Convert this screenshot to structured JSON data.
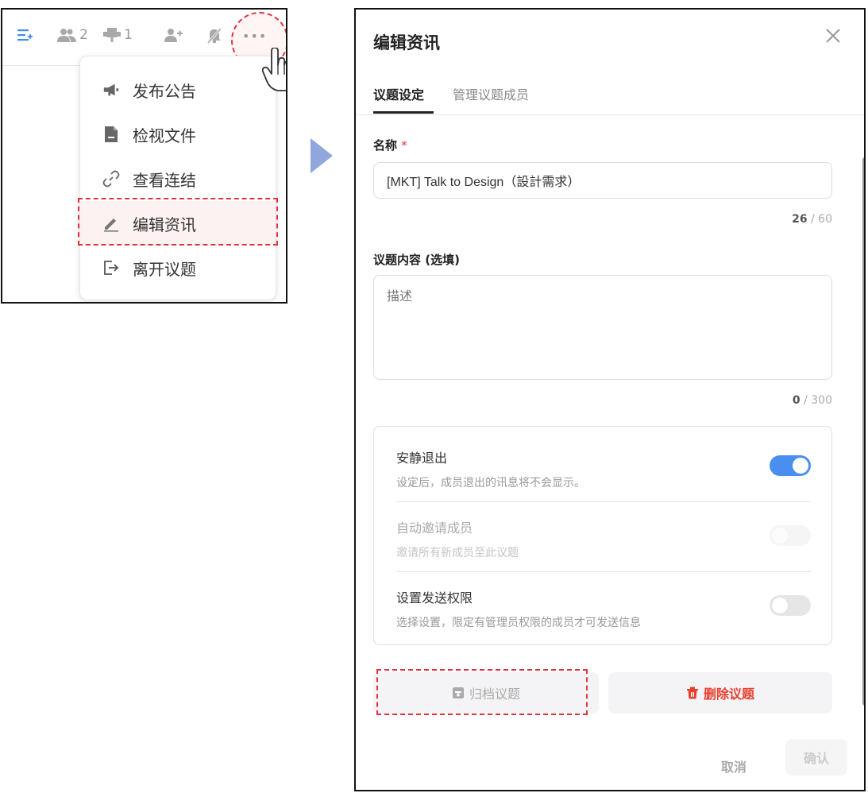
{
  "topbar": {
    "members_count": "2",
    "pin_count": "1",
    "more_label": "•••"
  },
  "menu": {
    "items": [
      {
        "label": "发布公告",
        "icon": "megaphone-icon"
      },
      {
        "label": "检视文件",
        "icon": "file-icon"
      },
      {
        "label": "查看连结",
        "icon": "link-icon"
      },
      {
        "label": "编辑资讯",
        "icon": "pencil-icon"
      },
      {
        "label": "离开议题",
        "icon": "exit-icon"
      }
    ]
  },
  "dialog": {
    "title": "编辑资讯",
    "tabs": [
      {
        "label": "议题设定",
        "active": true
      },
      {
        "label": "管理议题成员",
        "active": false
      }
    ],
    "name": {
      "label": "名称",
      "required_mark": "*",
      "value": "[MKT] Talk to Design（設計需求）",
      "count": "26",
      "max": "/ 60"
    },
    "content": {
      "label": "议题内容 (选填)",
      "placeholder": "描述",
      "count": "0",
      "max": "/ 300"
    },
    "settings": [
      {
        "title": "安静退出",
        "desc": "设定后，成员退出的讯息将不会显示。",
        "state": "on"
      },
      {
        "title": "自动邀请成员",
        "desc": "邀请所有新成员至此议题",
        "state": "disabled"
      },
      {
        "title": "设置发送权限",
        "desc": "选择设置，限定有管理员权限的成员才可发送信息",
        "state": "off"
      }
    ],
    "archive_label": "归档议题",
    "delete_label": "删除议题",
    "cancel_label": "取消",
    "confirm_label": "确认"
  },
  "colors": {
    "accent": "#4a8ff0",
    "danger": "#e8402f",
    "annotation": "#e0333f",
    "arrow": "#8fa7dd"
  }
}
